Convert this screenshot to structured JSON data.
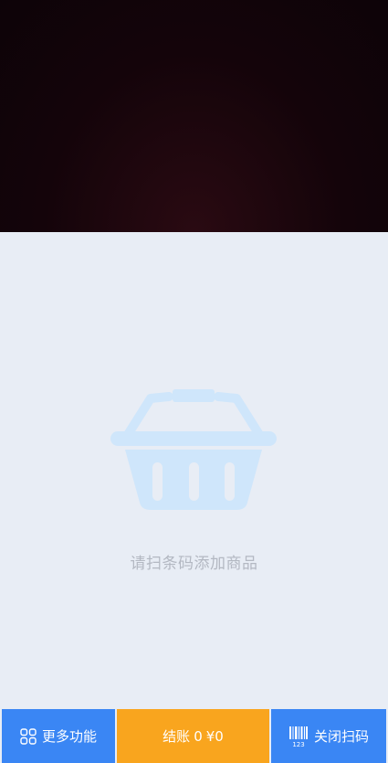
{
  "empty_state": {
    "message": "请扫条码添加商品"
  },
  "bottom_bar": {
    "more_label": "更多功能",
    "checkout_label": "结账",
    "checkout_count": "0",
    "checkout_amount": "¥0",
    "close_scan_label": "关闭扫码",
    "barcode_digits": "123"
  },
  "icons": {
    "more": "grid-four-squares-icon",
    "basket": "shopping-basket-icon",
    "close_scan": "barcode-icon"
  },
  "colors": {
    "primary": "#3a86f4",
    "checkout": "#f9a51e",
    "background": "#e8edf5",
    "basket": "#cfe6fb",
    "empty_text": "#b3b8c2"
  }
}
